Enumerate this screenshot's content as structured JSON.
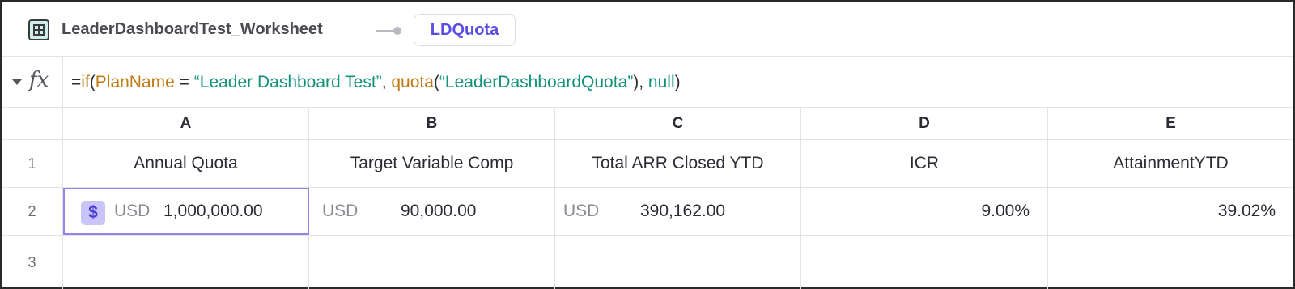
{
  "topbar": {
    "worksheet_title": "LeaderDashboardTest_Worksheet",
    "worksheet_icon": "table-grid-icon",
    "chip_label": "LDQuota"
  },
  "formula_bar": {
    "fx_label": "fx",
    "parts": {
      "eq": "=",
      "if": "if",
      "open1": "(",
      "planname": "PlanName",
      "op": " = ",
      "str1": "“Leader Dashboard Test”",
      "comma1": ", ",
      "quota": "quota",
      "open2": "(",
      "str2": "“LeaderDashboardQuota”",
      "close2": "), ",
      "null": "null",
      "close1": ")"
    }
  },
  "grid": {
    "columns": [
      "A",
      "B",
      "C",
      "D",
      "E"
    ],
    "rows": [
      "1",
      "2",
      "3"
    ],
    "headers": [
      "Annual Quota",
      "Target Variable Comp",
      "Total ARR Closed YTD",
      "ICR",
      "AttainmentYTD"
    ],
    "row2": {
      "a_currency": "USD",
      "a_value": "1,000,000.00",
      "a_icon": "$",
      "b_currency": "USD",
      "b_value": "90,000.00",
      "c_currency": "USD",
      "c_value": "390,162.00",
      "d_value": "9.00%",
      "e_value": "39.02%"
    }
  },
  "colors": {
    "function": "#c07a12",
    "string": "#12917a",
    "accent": "#5a4ee0",
    "selection": "#8f86e8"
  }
}
